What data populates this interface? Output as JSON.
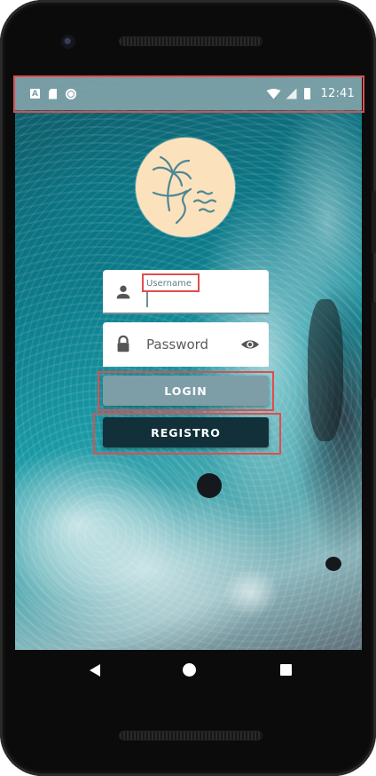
{
  "status_bar": {
    "left_icons": [
      "a-notification-icon",
      "sd-card-icon",
      "circle-notification-icon"
    ],
    "right_icons": [
      "wifi-icon",
      "signal-icon",
      "battery-icon"
    ],
    "time": "12:41"
  },
  "app": {
    "logo": "beach-palm-logo-icon",
    "username": {
      "label": "Username",
      "value": "",
      "icon": "person-icon"
    },
    "password": {
      "placeholder": "Password",
      "icon": "lock-icon",
      "toggle_icon": "eye-icon"
    },
    "login_button": "LOGIN",
    "register_button": "REGISTRO"
  },
  "nav_bar": {
    "back": "back-icon",
    "home": "home-icon",
    "recents": "recents-icon"
  },
  "colors": {
    "status_bar": "#7da0a8",
    "login_button": "#7d9ea6",
    "register_button": "#12303a",
    "logo_background": "#fbe2bd",
    "highlight": "#e04d4d"
  }
}
